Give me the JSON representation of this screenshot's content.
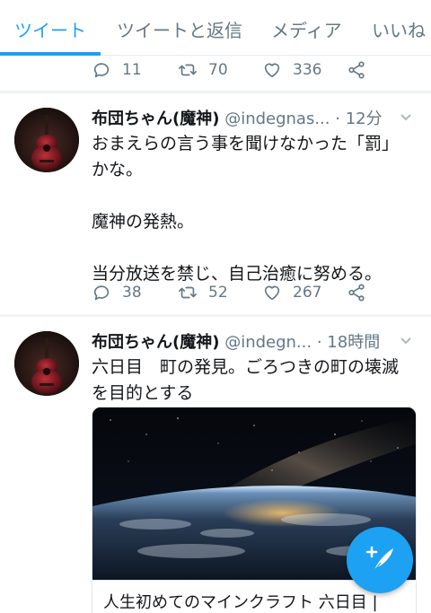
{
  "tabs": [
    {
      "label": "ツイート",
      "active": true
    },
    {
      "label": "ツイートと返信",
      "active": false
    },
    {
      "label": "メディア",
      "active": false
    },
    {
      "label": "いいね",
      "active": false
    }
  ],
  "accent_color": "#1da1f2",
  "top_actions": {
    "replies": "11",
    "retweets": "70",
    "likes": "336"
  },
  "tweets": [
    {
      "name": "布団ちゃん(魔神)",
      "handle": "@indegnas...",
      "time": "· 12分",
      "text_lines": [
        "おまえらの言う事を聞けなかった「罰」",
        "かな。",
        "",
        "魔神の発熱。",
        "",
        "当分放送を禁じ、自己治癒に努める。"
      ],
      "replies": "38",
      "retweets": "52",
      "likes": "267"
    },
    {
      "name": "布団ちゃん(魔神)",
      "handle": "@indegn...",
      "time": "· 18時間",
      "text_lines": [
        "六日目　町の発見。ごろつきの町の壊滅",
        "を目的とする"
      ],
      "media_caption": "人生初めてのマインクラフト 六日目 |"
    }
  ],
  "icons": {
    "reply": "reply-icon",
    "retweet": "retweet-icon",
    "like": "heart-icon",
    "share": "share-icon",
    "compose": "compose-tweet-icon"
  }
}
